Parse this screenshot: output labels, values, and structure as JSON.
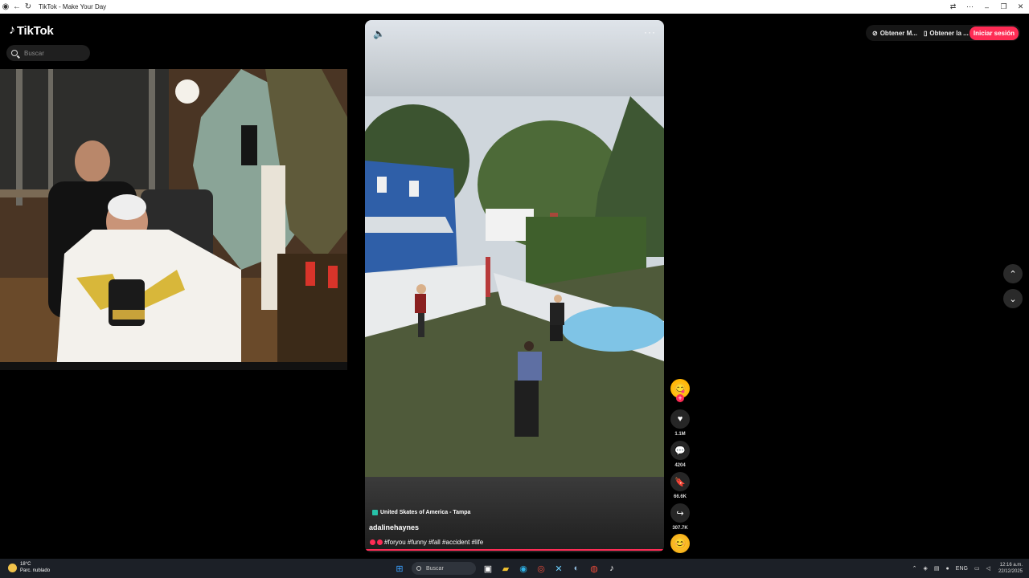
{
  "window": {
    "title": "TikTok - Make Your Day",
    "back_icon": "arrow-left-icon",
    "reload_icon": "reload-icon"
  },
  "header": {
    "logo_text": "TikTok",
    "search_placeholder": "Buscar",
    "actions": [
      {
        "icon": "app-icon",
        "label": "Obtener M..."
      },
      {
        "icon": "phone-icon",
        "label": "Obtener la ..."
      }
    ],
    "login_label": "Iniciar sesión"
  },
  "video": {
    "location": "United Skates of America - Tampa",
    "author": "adalinehaynes",
    "hashtags": "#foryou #funny #fall #accident #life",
    "progress": 1.0
  },
  "rail": {
    "likes": "1.1M",
    "comments": "4204",
    "saves": "66.6K",
    "shares": "307.7K"
  },
  "taskbar": {
    "weather_temp": "18°C",
    "weather_desc": "Parc. nublado",
    "search_label": "Buscar",
    "lang": "ENG",
    "time": "12:16 a.m.",
    "date": "22/12/2025"
  },
  "colors": {
    "accent": "#fe2c55",
    "background": "#000000"
  }
}
